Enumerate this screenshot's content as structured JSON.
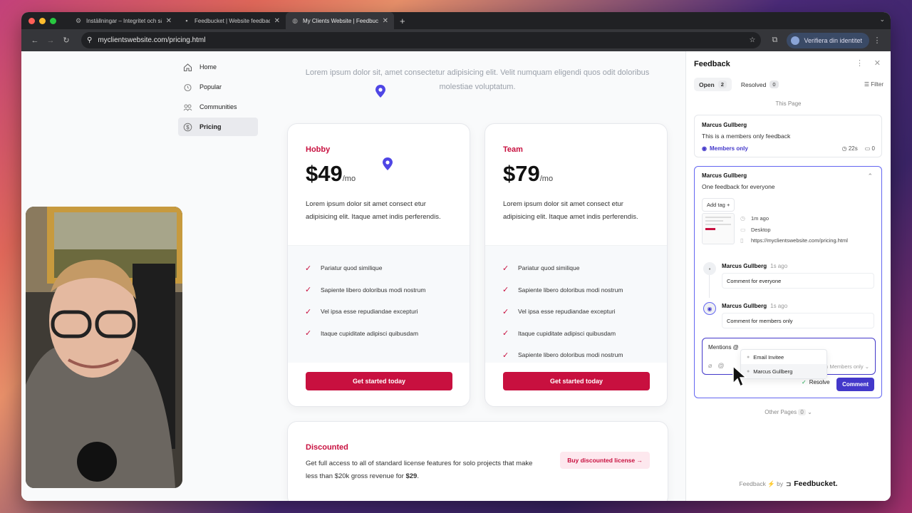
{
  "browser": {
    "tabs": [
      {
        "title": "Inställningar – Integritet och säkerhet",
        "icon": "gear-icon",
        "active": false
      },
      {
        "title": "Feedbucket | Website feedback",
        "icon": "feedbucket-icon",
        "active": false
      },
      {
        "title": "My Clients Website | Feedbucket",
        "icon": "globe-icon",
        "active": true
      }
    ],
    "new_tab": "+",
    "url": "myclientswebsite.com/pricing.html",
    "verify_label": "Verifiera din identitet"
  },
  "sidebar": {
    "items": [
      {
        "label": "Home",
        "icon": "home-icon"
      },
      {
        "label": "Popular",
        "icon": "popular-icon"
      },
      {
        "label": "Communities",
        "icon": "communities-icon"
      },
      {
        "label": "Pricing",
        "icon": "dollar-icon",
        "active": true
      }
    ]
  },
  "hero": {
    "lead": "Lorem ipsum dolor sit, amet consectetur adipisicing elit. Velit numquam eligendi quos odit doloribus molestiae voluptatum."
  },
  "plans": [
    {
      "name": "Hobby",
      "price": "$49",
      "period": "/mo",
      "desc": "Lorem ipsum dolor sit amet consect etur adipisicing elit. Itaque amet indis perferendis.",
      "features": [
        "Pariatur quod similique",
        "Sapiente libero doloribus modi nostrum",
        "Vel ipsa esse repudiandae excepturi",
        "Itaque cupiditate adipisci quibusdam"
      ],
      "cta": "Get started today"
    },
    {
      "name": "Team",
      "price": "$79",
      "period": "/mo",
      "desc": "Lorem ipsum dolor sit amet consect etur adipisicing elit. Itaque amet indis perferendis.",
      "features": [
        "Pariatur quod similique",
        "Sapiente libero doloribus modi nostrum",
        "Vel ipsa esse repudiandae excepturi",
        "Itaque cupiditate adipisci quibusdam",
        "Sapiente libero doloribus modi nostrum"
      ],
      "cta": "Get started today"
    }
  ],
  "discounted": {
    "name": "Discounted",
    "text": "Get full access to all of standard license features for solo projects that make less than $20k gross revenue for",
    "price": "$29",
    "cta": "Buy discounted license →"
  },
  "feedback": {
    "title": "Feedback",
    "tabs": [
      {
        "label": "Open",
        "count": "2"
      },
      {
        "label": "Resolved",
        "count": "0"
      }
    ],
    "filter": "Filter",
    "this_page": "This Page",
    "item1": {
      "author": "Marcus Gullberg",
      "message": "This is a members only feedback",
      "visibility": "Members only",
      "time": "22s",
      "comments": "0"
    },
    "item2": {
      "author": "Marcus Gullberg",
      "message": "One feedback for everyone",
      "add_tag": "Add tag +",
      "time": "1m ago",
      "device": "Desktop",
      "url": "https://myclientswebsite.com/pricing.html",
      "comments": [
        {
          "author": "Marcus Gullberg",
          "time": "1s ago",
          "text": "Comment for everyone"
        },
        {
          "author": "Marcus Gullberg",
          "time": "1s ago",
          "text": "Comment for members only"
        }
      ],
      "compose_value": "Mentions @",
      "compose_visibility": "Members only",
      "mention_options": [
        "Email Invitee",
        "Marcus Gullberg"
      ],
      "resolve": "Resolve",
      "comment_btn": "Comment"
    },
    "other_pages": "Other Pages",
    "other_pages_count": "0",
    "footer_prefix": "Feedback ⚡ by",
    "footer_brand": "Feedbucket."
  },
  "colors": {
    "accent": "#c8103f",
    "indigo": "#4338ca",
    "pin": "#4f46e5"
  }
}
